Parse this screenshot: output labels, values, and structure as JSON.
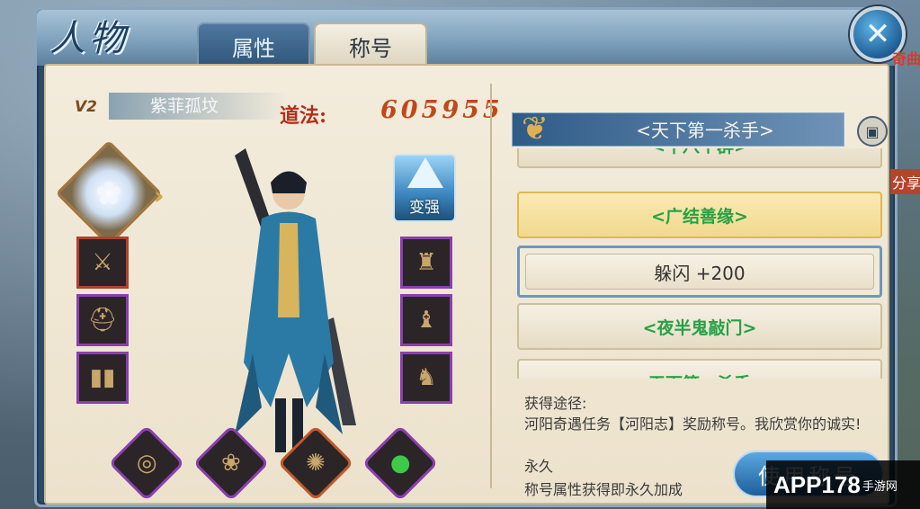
{
  "window": {
    "title": "人物",
    "tabs": [
      {
        "label": "属性",
        "active": false
      },
      {
        "label": "称号",
        "active": true
      }
    ],
    "close_icon": "close-icon"
  },
  "character": {
    "level": "V2",
    "name": "紫菲孤坟",
    "dao_label": "道法:",
    "dao_value": "605955",
    "strengthen_label": "变强",
    "equip_left": [
      "weapon-icon",
      "helmet-icon",
      "boots-icon"
    ],
    "equip_right": [
      "armor-icon",
      "shoulder-icon",
      "belt-icon"
    ],
    "accessories": [
      "ring-icon",
      "necklace-icon",
      "amulet-icon",
      "jade-icon"
    ]
  },
  "titles": {
    "current": "<天下第一杀手>",
    "list": [
      {
        "label": "<十八个群>",
        "state": "partial"
      },
      {
        "label": "<广结善缘>",
        "state": "selected"
      },
      {
        "label": "躲闪 +200",
        "state": "expanded"
      },
      {
        "label": "<夜半鬼敲门>",
        "state": "normal"
      },
      {
        "label": "<天下第一杀手>",
        "state": "partial"
      }
    ],
    "acquire_label": "获得途径:",
    "acquire_desc": "河阳奇遇任务【河阳志】奖励称号。我欣赏你的诚实!",
    "duration": "永久",
    "duration_note": "称号属性获得即永久加成",
    "use_button": "使用称号"
  },
  "side": {
    "top_label": "奇曲",
    "share_label": "分享"
  },
  "watermark": {
    "main": "APP178",
    "sub": "手游网"
  },
  "colors": {
    "title_green": "#27a145",
    "dao_red": "#b2301c",
    "frame_blue": "#2c4a66"
  }
}
